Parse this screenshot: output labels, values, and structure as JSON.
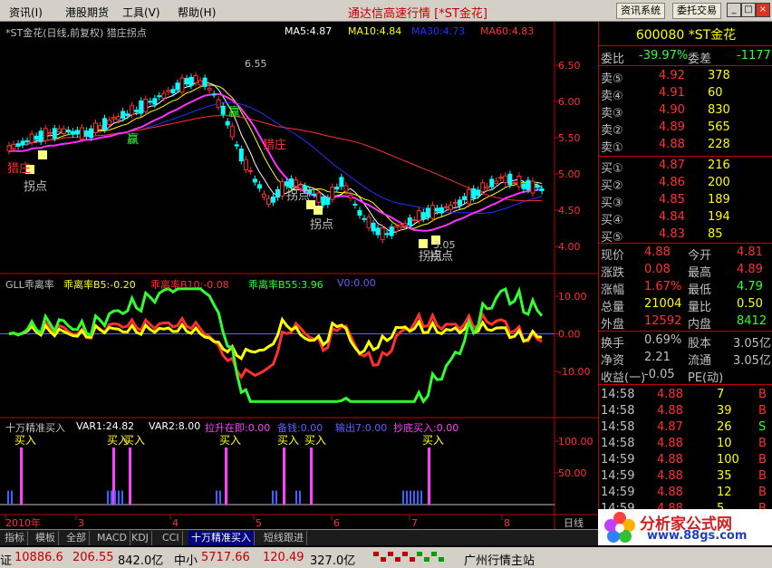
{
  "menu": {
    "items": [
      "资讯(I)",
      "港股期货",
      "工具(V)",
      "帮助(H)"
    ],
    "app_title": "通达信高速行情 [*ST金花]",
    "buttons": [
      "资讯系统",
      "委托交易"
    ]
  },
  "window_controls": [
    "_",
    "□",
    "×"
  ],
  "main_chart": {
    "title": "*ST金花(日线,前复权) 猎庄拐点",
    "ma": [
      {
        "label": "MA5:4.87",
        "color": "#ffffff"
      },
      {
        "label": "MA10:4.84",
        "color": "#ffff00"
      },
      {
        "label": "MA30:4.73",
        "color": "#2030ff"
      },
      {
        "label": "MA60:4.83",
        "color": "#ff3030"
      }
    ],
    "y_ticks": [
      "6.50",
      "6.00",
      "5.50",
      "5.00",
      "4.50",
      "4.00"
    ],
    "annotations": {
      "high": "6.55",
      "low": "3.05",
      "labels": [
        "猎庄",
        "拐点",
        "赢",
        "赢",
        "猎庄",
        "拐点",
        "拐点",
        "拐点",
        "拐点"
      ]
    }
  },
  "gll": {
    "title": "GLL乖离率",
    "vals": [
      {
        "label": "乖离率B5:-0.20",
        "color": "#ffff00"
      },
      {
        "label": "乖离率B10:-0.08",
        "color": "#ff3030"
      },
      {
        "label": "乖离率B55:3.96",
        "color": "#30ff30"
      },
      {
        "label": "V0:0.00",
        "color": "#6060ff"
      }
    ],
    "y_ticks": [
      "10.00",
      "0.00",
      "-10.00"
    ]
  },
  "buy": {
    "title": "十万精准买入",
    "vals": [
      {
        "label": "VAR1:24.82",
        "color": "#ffffff"
      },
      {
        "label": "VAR2:8.00",
        "color": "#ffffff"
      },
      {
        "label": "拉升在即:0.00",
        "color": "#ff40ff"
      },
      {
        "label": "备钱:0.00",
        "color": "#6060ff"
      },
      {
        "label": "输出7:0.00",
        "color": "#6060ff"
      },
      {
        "label": "抄底买入:0.00",
        "color": "#ff40ff"
      }
    ],
    "y_ticks": [
      "100.00",
      "50.00"
    ],
    "signal_label": "买入"
  },
  "x_axis": {
    "labels": [
      "2010年",
      "3",
      "4",
      "5",
      "6",
      "7",
      "8"
    ],
    "period": "日线"
  },
  "quote": {
    "code_name": "600080 *ST金花",
    "weibi": {
      "l1": "委比",
      "v1": "-39.97%",
      "l2": "委差",
      "v2": "-1177"
    },
    "sells": [
      {
        "label": "卖⑤",
        "price": "4.92",
        "vol": "378"
      },
      {
        "label": "卖④",
        "price": "4.91",
        "vol": "60"
      },
      {
        "label": "卖③",
        "price": "4.90",
        "vol": "830"
      },
      {
        "label": "卖②",
        "price": "4.89",
        "vol": "565"
      },
      {
        "label": "卖①",
        "price": "4.88",
        "vol": "228"
      }
    ],
    "buys": [
      {
        "label": "买①",
        "price": "4.87",
        "vol": "216"
      },
      {
        "label": "买②",
        "price": "4.86",
        "vol": "200"
      },
      {
        "label": "买③",
        "price": "4.85",
        "vol": "189"
      },
      {
        "label": "买④",
        "price": "4.84",
        "vol": "194"
      },
      {
        "label": "买⑤",
        "price": "4.83",
        "vol": "85"
      }
    ],
    "stats": [
      {
        "l1": "现价",
        "v1": "4.88",
        "l2": "今开",
        "v2": "4.81"
      },
      {
        "l1": "涨跌",
        "v1": "0.08",
        "l2": "最高",
        "v2": "4.89"
      },
      {
        "l1": "涨幅",
        "v1": "1.67%",
        "l2": "最低",
        "v2": "4.79"
      },
      {
        "l1": "总量",
        "v1": "21004",
        "l2": "量比",
        "v2": "0.50"
      },
      {
        "l1": "外盘",
        "v1": "12592",
        "l2": "内盘",
        "v2": "8412"
      }
    ],
    "fin": [
      {
        "l1": "换手",
        "v1": "0.69%",
        "l2": "股本",
        "v2": "3.05亿"
      },
      {
        "l1": "净资",
        "v1": "2.21",
        "l2": "流通",
        "v2": "3.05亿"
      },
      {
        "l1": "收益(一)",
        "v1": "-0.05",
        "l2": "PE(动)",
        "v2": ""
      }
    ],
    "ticks": [
      {
        "time": "14:58",
        "price": "4.88",
        "vol": "7",
        "side": "B"
      },
      {
        "time": "14:58",
        "price": "4.88",
        "vol": "39",
        "side": "B"
      },
      {
        "time": "14:58",
        "price": "4.87",
        "vol": "26",
        "side": "S"
      },
      {
        "time": "14:58",
        "price": "4.88",
        "vol": "10",
        "side": "B"
      },
      {
        "time": "14:59",
        "price": "4.88",
        "vol": "100",
        "side": "B"
      },
      {
        "time": "14:59",
        "price": "4.88",
        "vol": "35",
        "side": "B"
      },
      {
        "time": "14:59",
        "price": "4.88",
        "vol": "12",
        "side": "B"
      },
      {
        "time": "14:59",
        "price": "4.88",
        "vol": "5",
        "side": "B"
      }
    ]
  },
  "tabs": [
    "指标",
    "模板",
    "全部",
    "MACD",
    "KDJ",
    "CCI",
    "十万精准买入",
    "短线跟进"
  ],
  "indexbar": {
    "items": [
      "证",
      "10886.6",
      "206.55",
      "842.0亿",
      "中小",
      "5717.66",
      "120.49",
      "327.0亿"
    ],
    "server": "广州行情主站"
  },
  "logo": {
    "t1": "分析家公式网",
    "t2": "www.88gs.com"
  },
  "colors": {
    "up": "#ff3030",
    "down": "#00ffff",
    "label": "#c0c0c0",
    "axis": "#c00000",
    "accent": "#ffff00"
  }
}
